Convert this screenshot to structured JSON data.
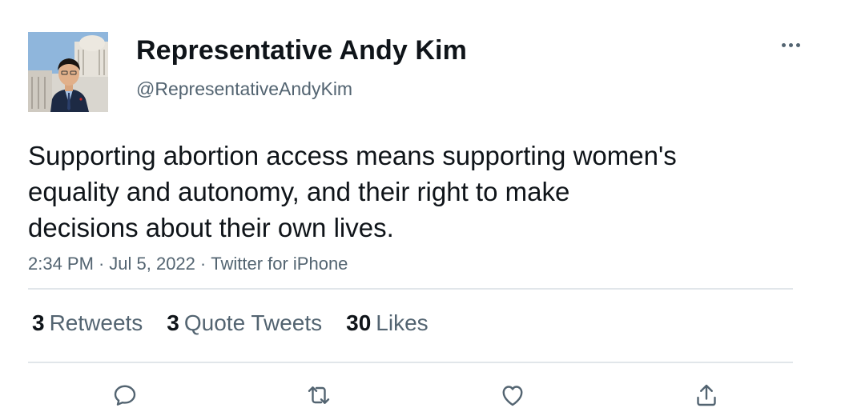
{
  "user": {
    "display_name": "Representative Andy Kim",
    "handle": "@RepresentativeAndyKim",
    "avatar_icon": "profile-photo"
  },
  "tweet": {
    "text_lines": [
      "Supporting abortion access means supporting women's",
      "equality and autonomy, and their right to make",
      "decisions about their own lives."
    ],
    "time": "2:34 PM",
    "date": "Jul 5, 2022",
    "source": "Twitter for iPhone",
    "separator": "·"
  },
  "stats": {
    "retweets_count": "3",
    "retweets_label": "Retweets",
    "quotes_count": "3",
    "quotes_label": "Quote Tweets",
    "likes_count": "30",
    "likes_label": "Likes"
  },
  "actions": [
    "reply-icon",
    "retweet-icon",
    "like-icon",
    "share-icon"
  ],
  "colors": {
    "text": "#0f1419",
    "secondary": "#536471",
    "divider": "#e1e6ea"
  }
}
